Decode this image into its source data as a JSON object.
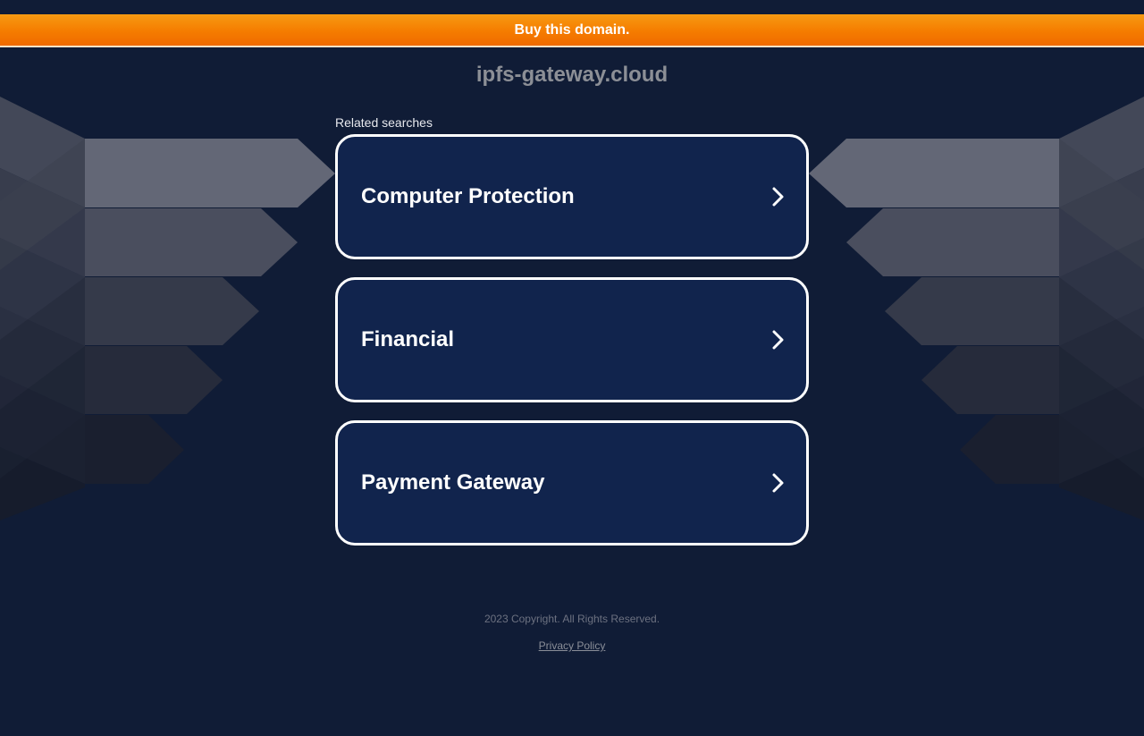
{
  "banner": {
    "label": "Buy this domain."
  },
  "site": {
    "domain": "ipfs-gateway.cloud"
  },
  "related": {
    "heading": "Related searches",
    "items": [
      {
        "label": "Computer Protection"
      },
      {
        "label": "Financial"
      },
      {
        "label": "Payment Gateway"
      }
    ]
  },
  "footer": {
    "copyright": "2023 Copyright. All Rights Reserved.",
    "privacy_label": "Privacy Policy"
  },
  "icons": {
    "card_arrow": "chevron-right-icon"
  },
  "colors": {
    "background": "#101c36",
    "banner": "#f57c00",
    "card_fill": "#11244d",
    "card_border": "#ffffff",
    "domain_text": "#8c8f96"
  }
}
